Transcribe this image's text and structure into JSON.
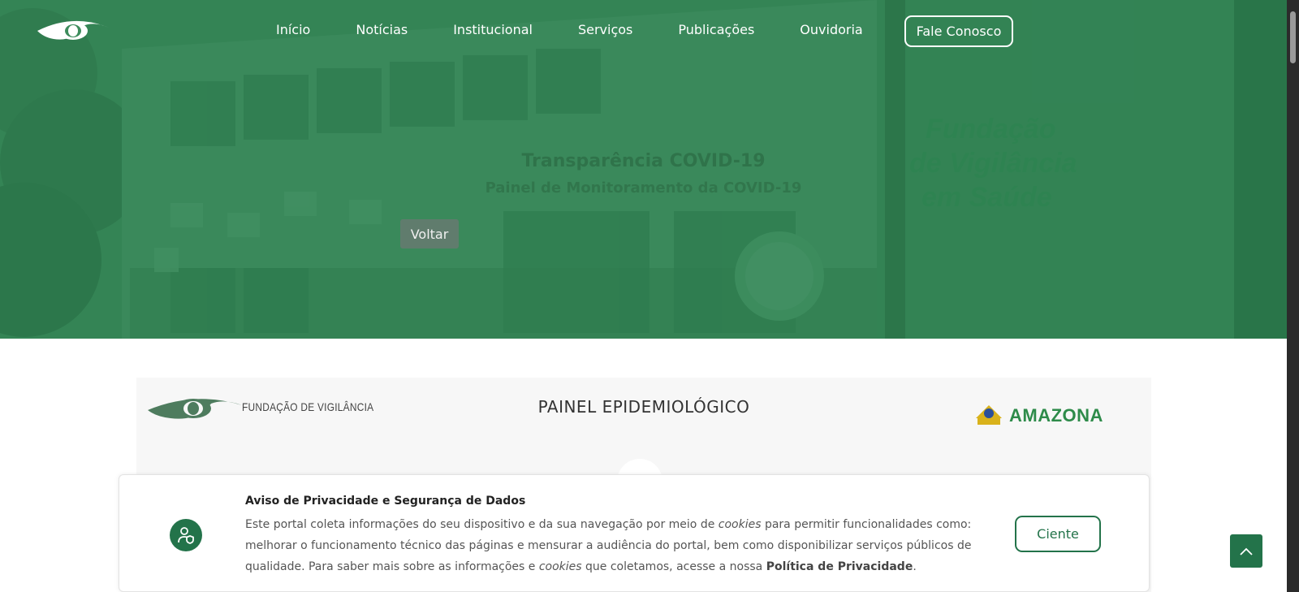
{
  "header": {
    "logo_icon": "eye-logo-icon",
    "nav": [
      "Início",
      "Notícias",
      "Institucional",
      "Serviços",
      "Publicações",
      "Ouvidoria"
    ],
    "cta_label": "Fale Conosco"
  },
  "hero": {
    "title": "Transparência COVID-19",
    "subtitle": "Painel de Monitoramento da COVID-19",
    "back_label": "Voltar",
    "colors": {
      "overlay": "#2f7d4f"
    }
  },
  "panel": {
    "left_logo_text": "FUNDAÇÃO DE VIGILÂNCIA",
    "title": "PAINEL EPIDEMIOLÓGICO",
    "right_logo_text": "AMAZONAS"
  },
  "cookie": {
    "icon": "user-shield-icon",
    "title": "Aviso de Privacidade e Segurança de Dados",
    "text_1": "Este portal coleta informações do seu dispositivo e da sua navegação por meio de ",
    "text_cookies_1": "cookies",
    "text_2": " para permitir funcionalidades como: melhorar o funcionamento técnico das páginas e mensurar a audiência do portal, bem como disponibilizar serviços públicos de qualidade. Para saber mais sobre as informações e ",
    "text_cookies_2": "cookies",
    "text_3": " que coletamos, acesse a nossa ",
    "policy_link": "Política de Privacidade",
    "text_end": ".",
    "accept_label": "Ciente",
    "colors": {
      "accent": "#23734a"
    }
  },
  "back_to_top_icon": "chevron-up-icon"
}
